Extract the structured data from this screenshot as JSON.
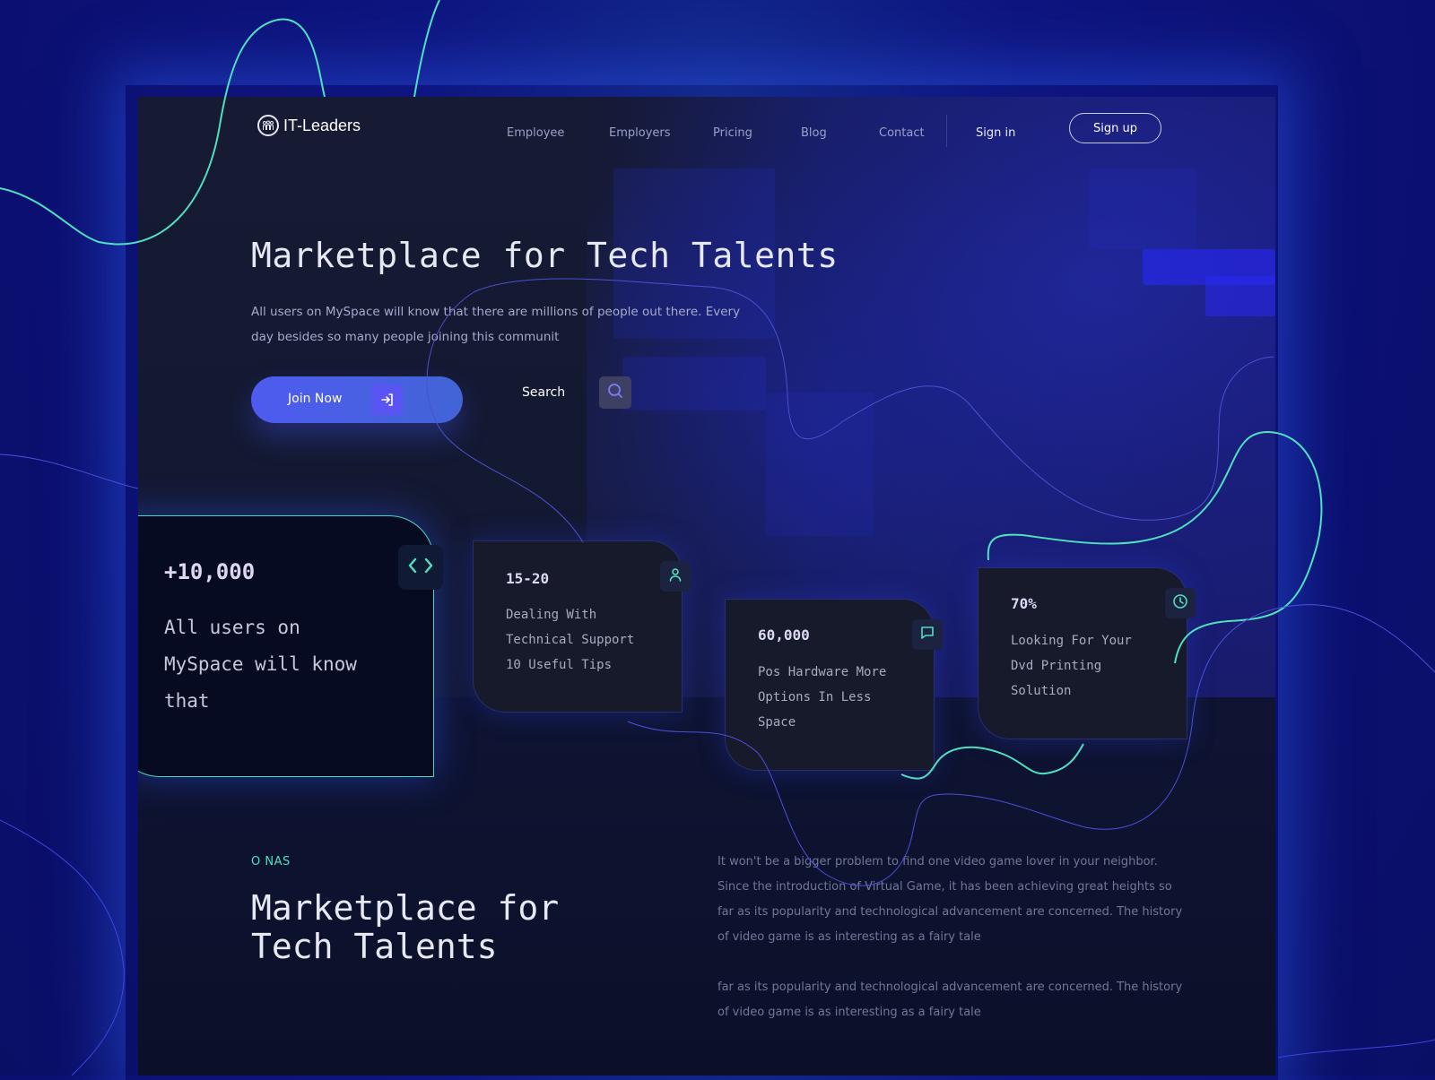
{
  "brand": {
    "name": "IT-Leaders",
    "logo_icon": "people-circle-icon"
  },
  "nav": {
    "items": [
      {
        "label": "Employee"
      },
      {
        "label": "Employers"
      },
      {
        "label": "Pricing"
      },
      {
        "label": "Blog"
      },
      {
        "label": "Contact"
      }
    ],
    "sign_in": "Sign in",
    "sign_up": "Sign up"
  },
  "hero": {
    "title": "Marketplace for Tech Talents",
    "description": "All users on MySpace will know that there are millions of people out there. Every day besides so many people joining this communit",
    "join_label": "Join Now",
    "join_icon": "sign-in-arrow-icon",
    "search_label": "Search",
    "search_icon": "search-icon"
  },
  "cards": [
    {
      "number": "+10,000",
      "text": "All users on\nMySpace will know\nthat",
      "icon": "code-brackets-icon"
    },
    {
      "number": "15-20",
      "text": "Dealing With\nTechnical Support\n10 Useful Tips",
      "icon": "user-icon"
    },
    {
      "number": "60,000",
      "text": "Pos Hardware More\nOptions In Less\nSpace",
      "icon": "chat-bubble-icon"
    },
    {
      "number": "70%",
      "text": "Looking For Your\nDvd Printing\nSolution",
      "icon": "clock-icon"
    }
  ],
  "about": {
    "eyebrow": "O NAS",
    "title": "Marketplace for\nTech Talents",
    "paragraph_1": "It won't be a bigger problem to find one video game lover in your neighbor. Since the introduction of Virtual Game, it has been achieving great heights so far as its popularity and technological advancement are concerned. The history of video game is as interesting as a fairy tale",
    "paragraph_2": "far as its popularity and technological advancement are concerned. The history of video game is as interesting as a fairy tale"
  },
  "colors": {
    "accent_teal": "#4fe0c0",
    "accent_blue": "#4f5bf0",
    "background_blue": "#0e1580",
    "panel_dark": "#161a33"
  }
}
